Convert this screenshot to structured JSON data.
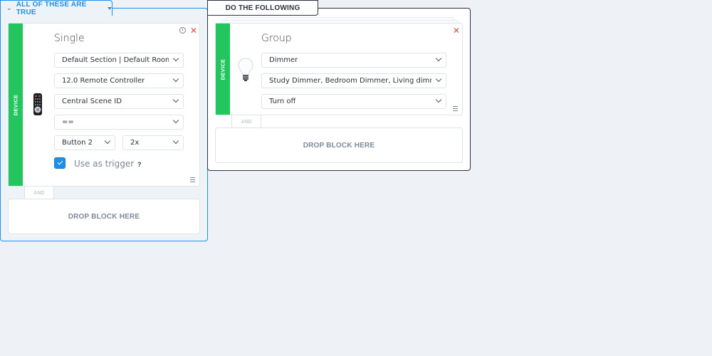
{
  "condition_panel": {
    "tab_label": "ALL OF THESE ARE TRUE",
    "card": {
      "type_label": "DEVICE",
      "title": "Single",
      "icon": "remote-control-icon",
      "location": "Default Section | Default Room",
      "device": "12.0 Remote Controller",
      "property": "Central Scene ID",
      "operator": "==",
      "button": "Button 2",
      "press_count": "2x",
      "use_as_trigger_label": "Use as trigger",
      "use_as_trigger_checked": true,
      "help_label": "?"
    },
    "connector_label": "AND",
    "drop_zone_label": "DROP BLOCK HERE"
  },
  "action_panel": {
    "tab_label": "DO THE FOLLOWING",
    "card": {
      "type_label": "DEVICE",
      "title": "Group",
      "icon": "light-bulb-icon",
      "device_type": "Dimmer",
      "devices": "Study Dimmer, Bedroom Dimmer, Living dimmer",
      "action": "Turn off"
    },
    "connector_label": "AND",
    "drop_zone_label": "DROP BLOCK HERE"
  },
  "colors": {
    "accent": "#1e90e8",
    "device_strip": "#22c55e",
    "delete": "#e0473b",
    "background": "#eef2f6"
  }
}
